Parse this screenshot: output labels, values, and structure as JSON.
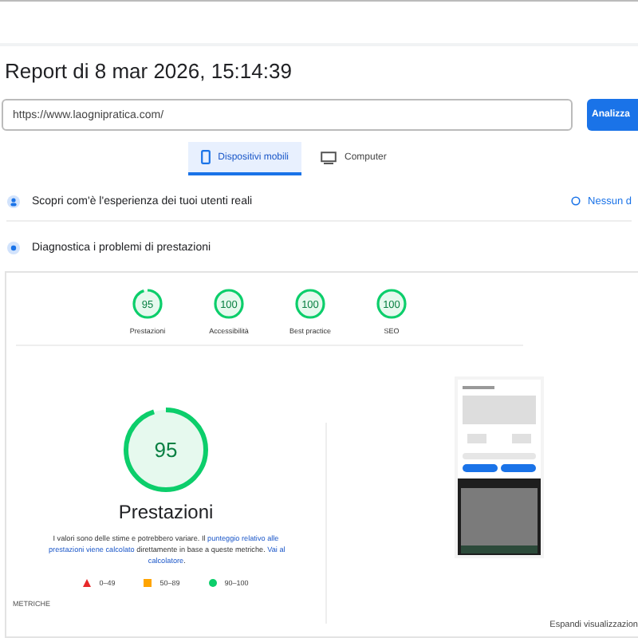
{
  "title": "Report di 8 mar 2026, 15:14:39",
  "url_field": {
    "value": "https://www.laognipratica.com/"
  },
  "analyze_button": "Analizza",
  "device_tabs": [
    {
      "label": "Dispositivi mobili",
      "kind": "mobile",
      "selected": true
    },
    {
      "label": "Computer",
      "kind": "desktop",
      "selected": false
    }
  ],
  "field_data": {
    "label": "Scopri com'è l'esperienza dei tuoi utenti reali",
    "status": "Nessun d"
  },
  "diagnostics": {
    "label": "Diagnostica i problemi di prestazioni",
    "scores": [
      {
        "score": "95",
        "label": "Prestazioni",
        "level": 0.95
      },
      {
        "score": "100",
        "label": "Accessibilità",
        "level": 1
      },
      {
        "score": "100",
        "label": "Best practice",
        "level": 1
      },
      {
        "score": "100",
        "label": "SEO",
        "level": 1
      }
    ],
    "main": {
      "score": "95",
      "label": "Prestazioni",
      "level": 0.95
    },
    "note": [
      {
        "text": "I valori sono delle stime e potrebbero variare. Il ",
        "link": false
      },
      {
        "text": "punteggio relativo alle",
        "link": true
      },
      {
        "text": "prestazioni viene calcolato",
        "link": true
      },
      {
        "text": " direttamente in base a queste metriche. ",
        "link": false
      },
      {
        "text": "Vai al",
        "link": true
      },
      {
        "text": "calcolatore",
        "link": true
      },
      {
        "text": ".",
        "link": false
      }
    ],
    "legend": [
      {
        "kind": "fail",
        "range": "0–49"
      },
      {
        "kind": "average",
        "range": "50–89"
      },
      {
        "kind": "pass",
        "range": "90–100"
      }
    ],
    "metrics_label": "METRICHE",
    "expand_link": "Espandi visualizzazion"
  }
}
